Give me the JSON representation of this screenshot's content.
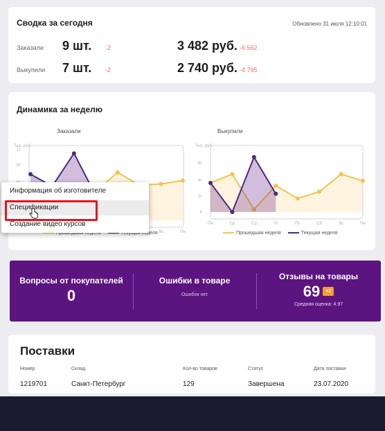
{
  "summary": {
    "title": "Сводка за сегодня",
    "updated": "Обновлено 31 июля 12:10:01",
    "rows": [
      {
        "label": "Заказали",
        "qty": "9 шт.",
        "qty_delta": "-2",
        "amount": "3 482 руб.",
        "amount_delta": "-6 562"
      },
      {
        "label": "Выкупили",
        "qty": "7 шт.",
        "qty_delta": "-2",
        "amount": "2 740 руб.",
        "amount_delta": "-4 795"
      }
    ]
  },
  "dynamics": {
    "title": "Динамика за неделю",
    "charts": [
      {
        "caption": "Заказали",
        "yunit": "Тыс. руб.",
        "yticks": [
          "1т",
          "8т",
          "6т",
          "4т",
          "2т",
          "0т"
        ],
        "days": [
          "Пн",
          "Вт",
          "Ср",
          "Чт",
          "Пт",
          "Сб",
          "Вс",
          "Пн"
        ],
        "series": [
          {
            "name": "Прошедшая неделя",
            "color": "#f7c24b",
            "values": [
              null,
              null,
              null,
              5.0,
              8.3,
              6.1,
              6.3,
              6.9
            ]
          },
          {
            "name": "Текущая неделя",
            "color": "#4a2a7e",
            "values": [
              8.0,
              5.9,
              11.6,
              4.3,
              null,
              null,
              null,
              null
            ]
          }
        ]
      },
      {
        "caption": "Выкупили",
        "yunit": "Тыс. руб.",
        "yticks": [
          "6т",
          "4т",
          "2т",
          "0"
        ],
        "days": [
          "Пн",
          "Ср",
          "Ср",
          "Чт",
          "Пт",
          "Сб",
          "Вс",
          "Пн"
        ],
        "series": [
          {
            "name": "Прошедшая неделя",
            "color": "#f7c24b",
            "values": [
              4.3,
              5.6,
              0.4,
              3.9,
              2.0,
              3.0,
              5.6,
              4.6
            ]
          },
          {
            "name": "Текущая неделя",
            "color": "#4a2a7e",
            "values": [
              4.3,
              0.0,
              8.1,
              2.7,
              null,
              null,
              null,
              null
            ]
          }
        ]
      }
    ],
    "legend": {
      "prev": "Прошедшая неделя",
      "curr": "Текущая неделя"
    }
  },
  "context_menu": {
    "items": [
      "Информация об изготовителе",
      "Спецификации",
      "Создание видео курсов"
    ],
    "highlighted_index": 1
  },
  "stats": [
    {
      "title": "Вопросы от покупателей",
      "value": "0"
    },
    {
      "title": "Ошибки в товаре",
      "note": "Ошибок нет"
    },
    {
      "title": "Отзывы на товары",
      "value": "69",
      "badge": "+2",
      "note": "Средняя оценка: 4.97"
    }
  ],
  "supplies": {
    "title": "Поставки",
    "headers": [
      "Номер",
      "Склад",
      "Кол-во товаров",
      "Статус",
      "Дата поставки"
    ],
    "rows": [
      [
        "1219701",
        "Санкт-Петербург",
        "129",
        "Завершена",
        "23.07.2020"
      ]
    ]
  },
  "colors": {
    "accent": "#5c1481",
    "prev_week": "#f7c24b",
    "curr_week": "#4a2a7e",
    "negative": "#f26a6a",
    "highlight_box": "#e8131c"
  },
  "icons": [
    "cursor-hand-icon"
  ]
}
